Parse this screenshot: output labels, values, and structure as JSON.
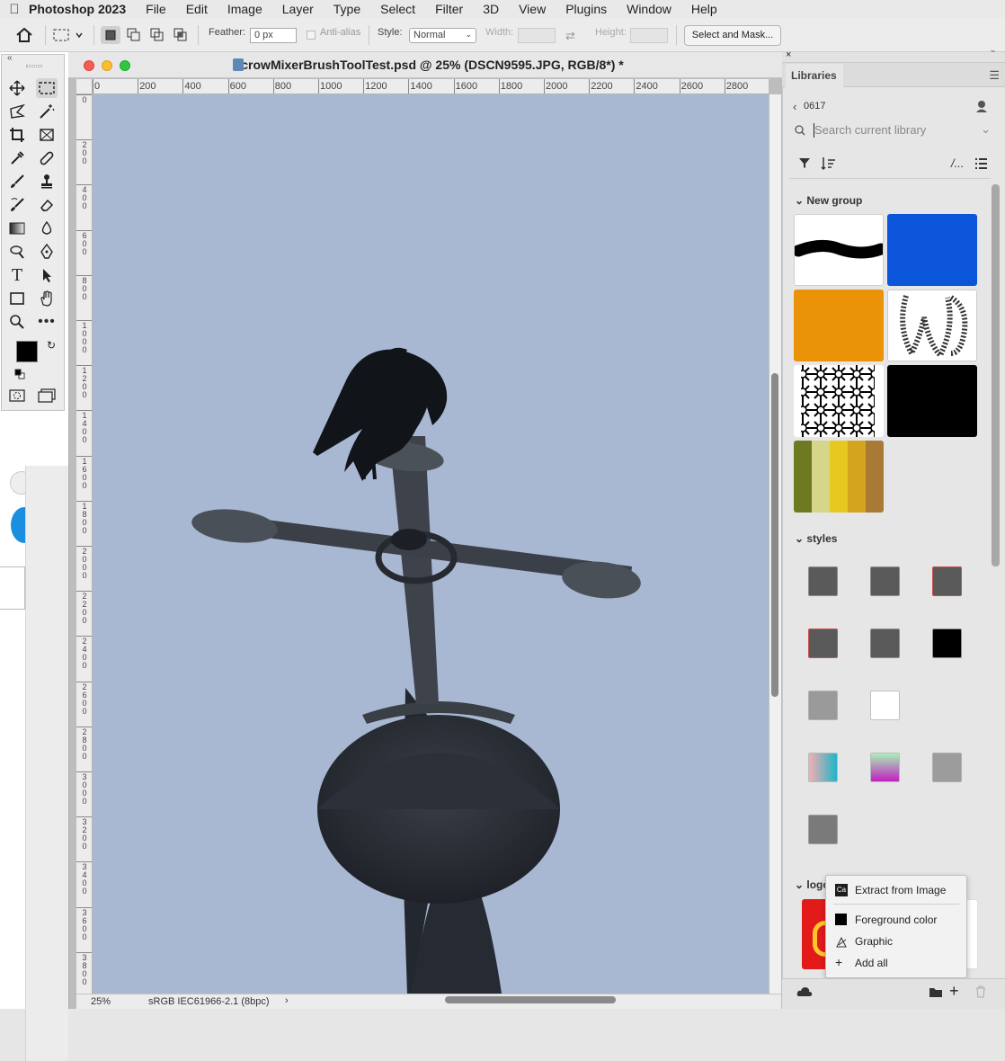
{
  "menubar": {
    "app_name": "Photoshop 2023",
    "items": [
      "File",
      "Edit",
      "Image",
      "Layer",
      "Type",
      "Select",
      "Filter",
      "3D",
      "View",
      "Plugins",
      "Window",
      "Help"
    ]
  },
  "options": {
    "feather_label": "Feather:",
    "feather_value": "0 px",
    "antialias_label": "Anti-alias",
    "style_label": "Style:",
    "style_value": "Normal",
    "width_label": "Width:",
    "height_label": "Height:",
    "select_mask_label": "Select and Mask..."
  },
  "document": {
    "title": "crowMixerBrushToolTest.psd @ 25% (DSCN9595.JPG, RGB/8*) *",
    "ruler_h": [
      "0",
      "200",
      "400",
      "600",
      "800",
      "1000",
      "1200",
      "1400",
      "1600",
      "1800",
      "2000",
      "2200",
      "2400",
      "2600",
      "2800"
    ],
    "ruler_v": [
      "0",
      "200",
      "400",
      "600",
      "800",
      "1000",
      "1200",
      "1400",
      "1600",
      "1800",
      "2000",
      "2200",
      "2400",
      "2600",
      "2800",
      "3000",
      "3200",
      "3400",
      "3600",
      "3800"
    ],
    "zoom": "25%",
    "color_profile": "sRGB IEC61966-2.1 (8bpc)"
  },
  "libraries": {
    "tab_label": "Libraries",
    "library_name": "0617",
    "search_placeholder": "Search current library",
    "group_new": "New group",
    "group_styles": "styles",
    "group_logo": "logo",
    "tile_colors": {
      "blue": "#0a55d9",
      "orange": "#ea9308",
      "black": "#000000"
    },
    "palette": [
      "#6e7a22",
      "#d6d68a",
      "#e6c820",
      "#d4a41e",
      "#a87a36"
    ]
  },
  "popup_menu": {
    "items": [
      "Extract from Image",
      "Foreground color",
      "Graphic",
      "Add all"
    ]
  }
}
